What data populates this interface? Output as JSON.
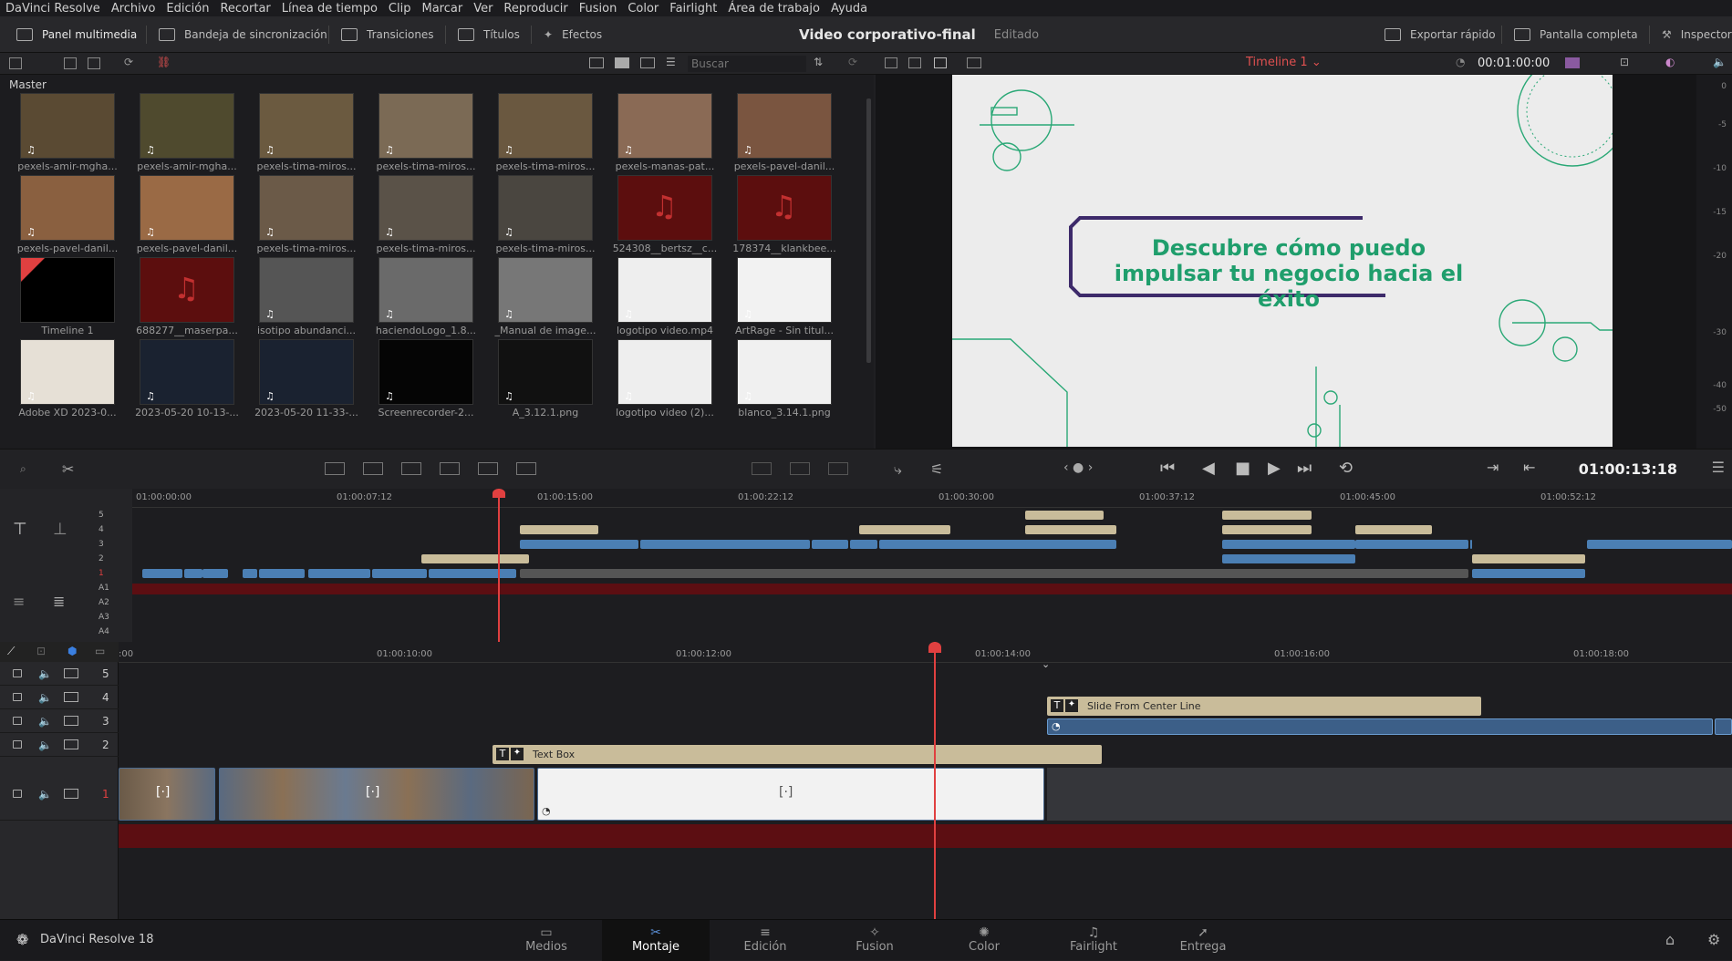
{
  "menu": [
    "DaVinci Resolve",
    "Archivo",
    "Edición",
    "Recortar",
    "Línea de tiempo",
    "Clip",
    "Marcar",
    "Ver",
    "Reproducir",
    "Fusion",
    "Color",
    "Fairlight",
    "Área de trabajo",
    "Ayuda"
  ],
  "toolbar": {
    "media_pool": "Panel multimedia",
    "sync_bin": "Bandeja de sincronización",
    "transitions": "Transiciones",
    "titles": "Títulos",
    "effects": "Efectos",
    "project_title": "Video corporativo-final",
    "project_status": "Editado",
    "quick_export": "Exportar rápido",
    "fullscreen": "Pantalla completa",
    "inspector": "Inspector"
  },
  "media_pool": {
    "bin": "Master",
    "search_placeholder": "Buscar",
    "clips": [
      {
        "name": "pexels-amir-mgha...",
        "type": "video",
        "color": "#5a4a33"
      },
      {
        "name": "pexels-amir-mgha...",
        "type": "video",
        "color": "#4f4a2e"
      },
      {
        "name": "pexels-tima-miros...",
        "type": "video",
        "color": "#6b5a40"
      },
      {
        "name": "pexels-tima-miros...",
        "type": "video",
        "color": "#7b6a55"
      },
      {
        "name": "pexels-tima-miros...",
        "type": "video",
        "color": "#6a5840"
      },
      {
        "name": "pexels-manas-pat...",
        "type": "video",
        "color": "#8a6a55"
      },
      {
        "name": "pexels-pavel-danil...",
        "type": "video",
        "color": "#7a5540"
      },
      {
        "name": "pexels-pavel-danil...",
        "type": "video",
        "color": "#8a6040"
      },
      {
        "name": "pexels-pavel-danil...",
        "type": "video",
        "color": "#9a6a45"
      },
      {
        "name": "pexels-tima-miros...",
        "type": "video",
        "color": "#6b5a48"
      },
      {
        "name": "pexels-tima-miros...",
        "type": "video",
        "color": "#5a5248"
      },
      {
        "name": "pexels-tima-miros...",
        "type": "video",
        "color": "#4a4640"
      },
      {
        "name": "524308__bertsz__c...",
        "type": "audio",
        "color": "#5c0e0e"
      },
      {
        "name": "178374__klankbee...",
        "type": "audio",
        "color": "#5c0e0e"
      },
      {
        "name": "Timeline 1",
        "type": "timeline",
        "color": "#000000"
      },
      {
        "name": "688277__maserpa...",
        "type": "audio",
        "color": "#5c0e0e"
      },
      {
        "name": "isotipo abundanci...",
        "type": "image",
        "color": "#555555"
      },
      {
        "name": "haciendoLogo_1.8...",
        "type": "image",
        "color": "#6a6a6a"
      },
      {
        "name": "_Manual de image...",
        "type": "image",
        "color": "#777777"
      },
      {
        "name": "logotipo video.mp4",
        "type": "video",
        "color": "#eeeeee"
      },
      {
        "name": "ArtRage - Sin titul...",
        "type": "image",
        "color": "#f2f2f2"
      },
      {
        "name": "Adobe XD 2023-0...",
        "type": "image",
        "color": "#e6e0d6"
      },
      {
        "name": "2023-05-20 10-13-...",
        "type": "video",
        "color": "#1a2230"
      },
      {
        "name": "2023-05-20 11-33-...",
        "type": "video",
        "color": "#1a2230"
      },
      {
        "name": "Screenrecorder-2...",
        "type": "video",
        "color": "#050505"
      },
      {
        "name": "A_3.12.1.png",
        "type": "image",
        "color": "#111111"
      },
      {
        "name": "logotipo video (2)...",
        "type": "video",
        "color": "#eeeeee"
      },
      {
        "name": "blanco_3.14.1.png",
        "type": "image",
        "color": "#f0f0f0"
      }
    ]
  },
  "viewer": {
    "timeline_name": "Timeline 1",
    "duration": "00:01:00:00",
    "headline": "Descubre cómo puedo impulsar tu negocio hacia el éxito",
    "timecode": "01:00:13:18",
    "meter_ticks": [
      "0",
      "-5",
      "-10",
      "-15",
      "-20",
      "-30",
      "-40",
      "-50"
    ]
  },
  "mini_timeline": {
    "ruler": [
      "01:00:00:00",
      "01:00:07:12",
      "01:00:15:00",
      "01:00:22:12",
      "01:00:30:00",
      "01:00:37:12",
      "01:00:45:00",
      "01:00:52:12"
    ],
    "video_tracks": [
      "5",
      "4",
      "3",
      "2",
      "1"
    ],
    "audio_tracks": [
      "A1",
      "A2",
      "A3",
      "A4"
    ]
  },
  "main_timeline": {
    "ruler": [
      ":00",
      "01:00:10:00",
      "01:00:12:00",
      "01:00:14:00",
      "01:00:16:00",
      "01:00:18:00"
    ],
    "tracks": [
      "5",
      "4",
      "3",
      "2",
      "1"
    ],
    "clips": {
      "slide_from_center": "Slide From Center Line",
      "text_box": "Text Box"
    }
  },
  "pages": [
    "Medios",
    "Montaje",
    "Edición",
    "Fusion",
    "Color",
    "Fairlight",
    "Entrega"
  ],
  "active_page": "Montaje",
  "brand": "DaVinci Resolve 18",
  "colors": {
    "accent": "#1f9e6c",
    "playhead": "#e04040",
    "clip_blue": "#4b7fb4",
    "title_clip": "#c9bc9a",
    "timeline_red": "#e05050"
  }
}
